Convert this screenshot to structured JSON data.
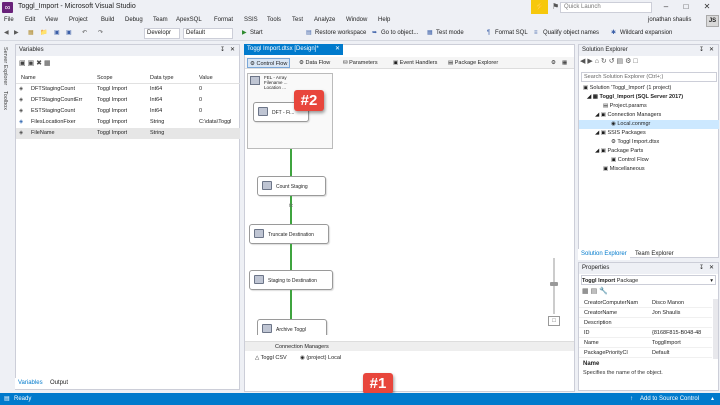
{
  "window": {
    "title": "Toggl_Import - Microsoft Visual Studio",
    "quick_launch": "Quick Launch",
    "user": "jonathan shaulis",
    "user_initials": "JS"
  },
  "menu": [
    "File",
    "Edit",
    "View",
    "Project",
    "Build",
    "Debug",
    "Team",
    "ApexSQL",
    "Format",
    "SSIS",
    "Tools",
    "Test",
    "Analyze",
    "Window",
    "Help"
  ],
  "toolbar": {
    "config": "Developr",
    "platform": "Default",
    "start": "Start",
    "restore": "Restore workspace",
    "goto": "Go to object...",
    "testmode": "Test mode",
    "format": "Format SQL",
    "qualify": "Qualify object names",
    "wildcard": "Wildcard expansion"
  },
  "left_strip": {
    "server_explorer": "Server Explorer",
    "toolbox": "Toolbox"
  },
  "variables": {
    "title": "Variables",
    "headers": {
      "name": "Name",
      "scope": "Scope",
      "type": "Data type",
      "value": "Value"
    },
    "rows": [
      {
        "name": "DFTStagingCount",
        "scope": "Toggl Import",
        "type": "Int64",
        "value": "0"
      },
      {
        "name": "DFTStagingCountErr",
        "scope": "Toggl Import",
        "type": "Int64",
        "value": "0"
      },
      {
        "name": "ESTStagingCount",
        "scope": "Toggl Import",
        "type": "Int64",
        "value": "0"
      },
      {
        "name": "FilesLocationFixer",
        "scope": "Toggl Import",
        "type": "String",
        "value": "C:\\data\\Toggl"
      },
      {
        "name": "FileName",
        "scope": "Toggl Import",
        "type": "String",
        "value": ""
      }
    ],
    "tabs": {
      "variables": "Variables",
      "output": "Output"
    }
  },
  "document": {
    "tab": "Toggl Import.dtsx [Design]*",
    "design_tabs": {
      "control_flow": "Control Flow",
      "data_flow": "Data Flow",
      "parameters": "Parameters",
      "event_handlers": "Event Handlers",
      "package_explorer": "Package Explorer"
    },
    "container_lines": {
      "l1": "FEL - Array",
      "l2": "Filename ...",
      "l3": "Location ..."
    },
    "tasks": {
      "dft": "DFT - Fi...",
      "count": "Count Staging",
      "truncate": "Truncate Destination",
      "staging": "Staging to Destination",
      "archive": "Archive Toggl"
    },
    "fx": "fx",
    "connection_managers": {
      "title": "Connection Managers",
      "item1": "Toggl CSV",
      "item2": "(project) Local"
    }
  },
  "callouts": {
    "one": "#1",
    "two": "#2"
  },
  "solution_explorer": {
    "title": "Solution Explorer",
    "search": "Search Solution Explorer (Ctrl+;)",
    "tree": {
      "solution": "Solution 'Toggl_Import' (1 project)",
      "project": "Toggl_Import (SQL Server 2017)",
      "params": "Project.params",
      "conn_mgrs": "Connection Managers",
      "local": "Local.conmgr",
      "ssis_packages": "SSIS Packages",
      "toggl_dtsx": "Toggl Import.dtsx",
      "package_parts": "Package Parts",
      "control_flow": "Control Flow",
      "misc": "Miscellaneous"
    },
    "tabs": {
      "se": "Solution Explorer",
      "te": "Team Explorer"
    }
  },
  "properties": {
    "title": "Properties",
    "object": "Toggl Import",
    "object_type": "Package",
    "rows": [
      {
        "name": "CreatorComputerNam",
        "value": "Disco Manon"
      },
      {
        "name": "CreatorName",
        "value": "Jon Shaulis"
      },
      {
        "name": "Description",
        "value": ""
      },
      {
        "name": "ID",
        "value": "{8168F815-B048-48"
      },
      {
        "name": "Name",
        "value": "TogglImport"
      },
      {
        "name": "PackagePriorityCl",
        "value": "Default"
      }
    ],
    "desc_title": "Name",
    "desc_text": "Specifies the name of the object."
  },
  "status": {
    "ready": "Ready",
    "source_control": "Add to Source Control"
  },
  "colors": {
    "accent": "#007acc",
    "callout": "#e8463c",
    "connector": "#3fa43f"
  }
}
